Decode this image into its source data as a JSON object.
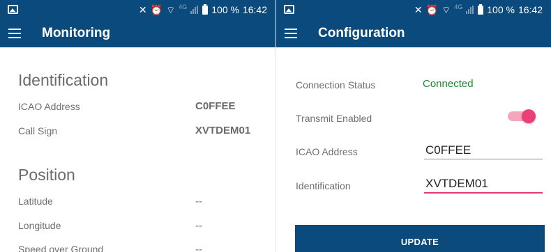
{
  "status_bar": {
    "icons": [
      "gallery-icon",
      "vibrate-icon",
      "alarm-icon",
      "wifi-icon",
      "signal-icon",
      "battery-icon"
    ],
    "network": "4G",
    "battery": "100 %",
    "time": "16:42"
  },
  "monitoring": {
    "title": "Monitoring",
    "identification": {
      "heading": "Identification",
      "icao_label": "ICAO Address",
      "icao_value": "C0FFEE",
      "callsign_label": "Call Sign",
      "callsign_value": "XVTDEM01"
    },
    "position": {
      "heading": "Position",
      "latitude_label": "Latitude",
      "latitude_value": "--",
      "longitude_label": "Longitude",
      "longitude_value": "--",
      "speed_label": "Speed over Ground",
      "speed_value": "--"
    }
  },
  "configuration": {
    "title": "Configuration",
    "connection_label": "Connection Status",
    "connection_value": "Connected",
    "transmit_label": "Transmit Enabled",
    "transmit_enabled": true,
    "icao_label": "ICAO Address",
    "icao_value": "C0FFEE",
    "identification_label": "Identification",
    "identification_value": "XVTDEM01",
    "update_label": "UPDATE"
  },
  "colors": {
    "primary": "#0b4a7c",
    "connected": "#1a8a2e",
    "accent": "#ea3f77"
  }
}
